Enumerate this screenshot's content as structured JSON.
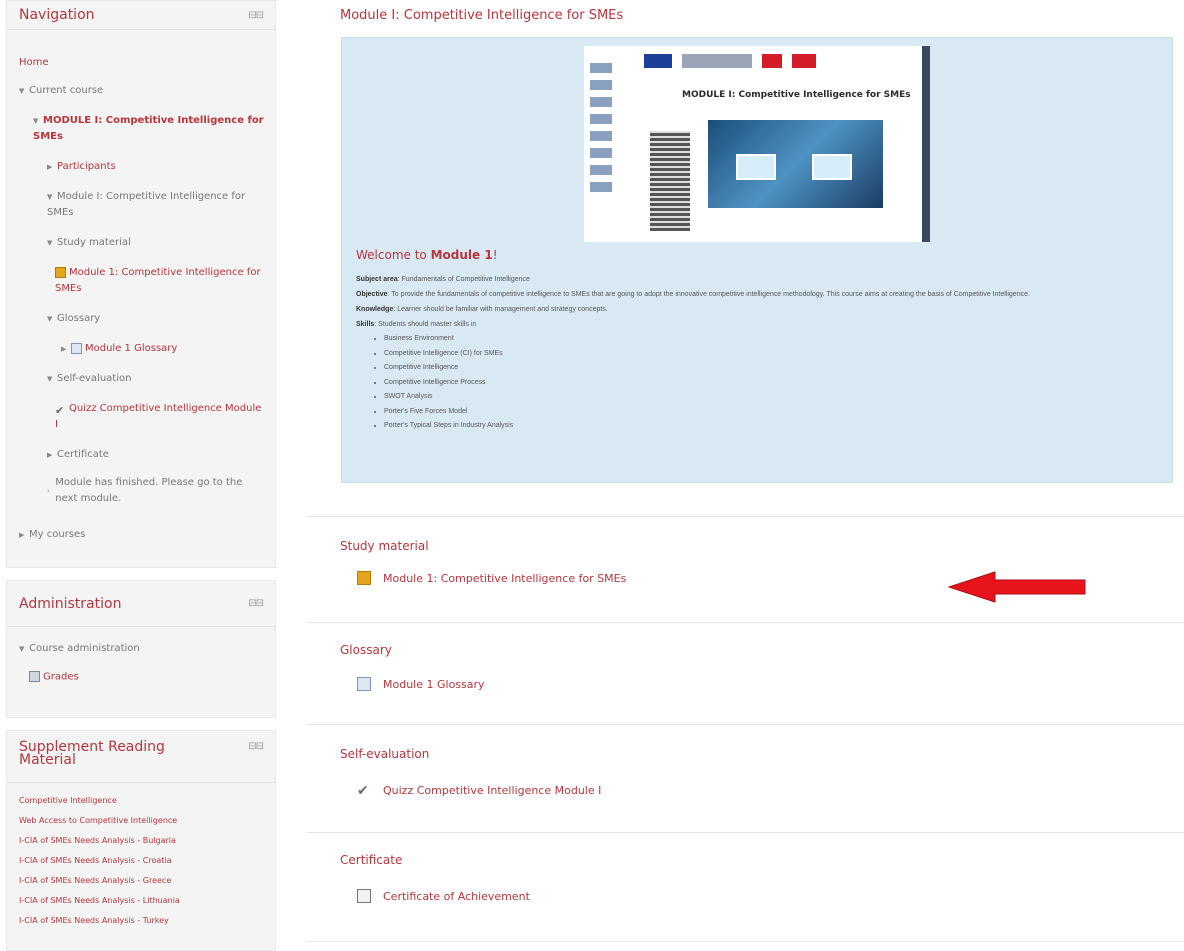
{
  "navigation": {
    "title": "Navigation",
    "home": "Home",
    "current_course": "Current course",
    "course_name": "MODULE I: Competitive Intelligence for SMEs",
    "participants": "Participants",
    "section_module": "Module I: Competitive Intelligence for SMEs",
    "section_study": "Study material",
    "study_item": "Module 1: Competitive Intelligence for SMEs",
    "section_glossary": "Glossary",
    "glossary_item": "Module 1 Glossary",
    "section_self": "Self-evaluation",
    "quiz_item": "Quizz Competitive Intelligence Module I",
    "section_certificate": "Certificate",
    "finished_note": "Module has finished. Please go to the next module.",
    "my_courses": "My courses"
  },
  "administration": {
    "title": "Administration",
    "course_admin": "Course administration",
    "grades": "Grades"
  },
  "supplement": {
    "title": "Supplement Reading Material",
    "links": [
      "Competitive Intelligence",
      "Web Access to Competitive Intelligence",
      "I-CIA of SMEs Needs Analysis - Bulgaria",
      "I-CIA of SMEs Needs Analysis - Croatia",
      "I-CIA of SMEs Needs Analysis - Greece",
      "I-CIA of SMEs Needs Analysis - Lithuania",
      "I-CIA of SMEs Needs Analysis - Turkey"
    ]
  },
  "main": {
    "title": "Module I: Competitive Intelligence for SMEs",
    "banner_title": "MODULE I: Competitive Intelligence for SMEs",
    "welcome_prefix": "Welcome to ",
    "welcome_bold": "Module 1",
    "welcome_suffix": "!",
    "subject_label": "Subject area",
    "subject_text": ": Fundamentals of Competitive Intelligence",
    "objective_label": "Objective",
    "objective_text": ": To provide the fundamentals of competitive intelligence to SMEs that are going to adopt the innovative competitive intelligence methodology. This course aims at creating the basis of Competitive Intelligence.",
    "knowledge_label": "Knowledge",
    "knowledge_text": ": Learner should be familiar with management and strategy concepts.",
    "skills_label": "Skills",
    "skills_text": ": Students should master skills in",
    "skills_list": [
      "Business Environment",
      "Competitive Intelligence (CI) for SMEs",
      "Competitive Intelligence",
      "Competitive Intelligence Process",
      "SWOT Analysis",
      "Porter's Five Forces Model",
      "Porter's Typical Steps in Industry Analysis"
    ],
    "sections": {
      "study": {
        "name": "Study material",
        "activity": "Module 1: Competitive Intelligence for SMEs"
      },
      "glossary": {
        "name": "Glossary",
        "activity": "Module 1 Glossary"
      },
      "self": {
        "name": "Self-evaluation",
        "activity": "Quizz Competitive Intelligence Module I"
      },
      "certificate": {
        "name": "Certificate",
        "activity": "Certificate of Achievement"
      }
    }
  },
  "colors": {
    "link": "#b8353c",
    "summary_bg": "#d9e9f3",
    "arrow": "#e8141b"
  }
}
